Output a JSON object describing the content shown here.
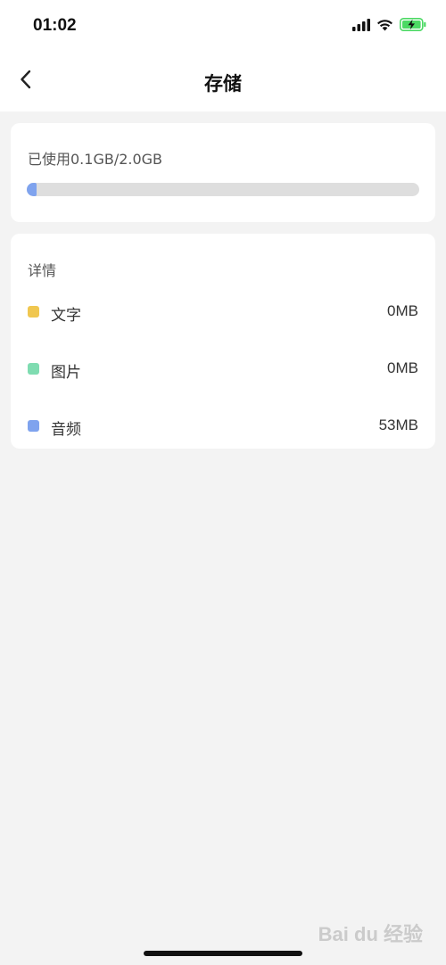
{
  "status_bar": {
    "time": "01:02"
  },
  "header": {
    "title": "存储"
  },
  "usage": {
    "text": "已使用0.1GB/2.0GB",
    "progress_fraction": 0.025
  },
  "details": {
    "title": "详情",
    "items": [
      {
        "label": "文字",
        "value": "0MB",
        "color": "#f0c750"
      },
      {
        "label": "图片",
        "value": "0MB",
        "color": "#7fdcb1"
      },
      {
        "label": "音频",
        "value": "53MB",
        "color": "#7fa3ee"
      }
    ]
  },
  "colors": {
    "background": "#f3f3f3",
    "progress_track": "#dedede",
    "progress_fill": "#7fa3ee"
  },
  "watermark": {
    "text": "Bai du 经验"
  }
}
